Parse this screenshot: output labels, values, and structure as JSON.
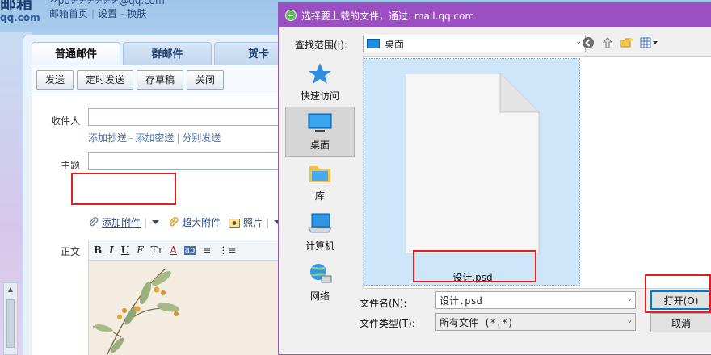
{
  "brand": {
    "logo_main": "邮箱",
    "logo_sub": "qq.com"
  },
  "header": {
    "email": "‹‹pu≠≠≠≠≠≠@qq.com",
    "links": [
      "邮箱首页",
      "设置",
      "换肤"
    ]
  },
  "compose": {
    "tabs": [
      "普通邮件",
      "群邮件",
      "贺卡"
    ],
    "toolbar": [
      "发送",
      "定时发送",
      "存草稿",
      "关闭"
    ],
    "to_label": "收件人",
    "cc_links": [
      "添加抄送",
      "添加密送",
      "分别发送"
    ],
    "subject_label": "主题",
    "attach": {
      "add_attachment": "添加附件",
      "large_attachment": "超大附件",
      "photo": "照片"
    },
    "body_label": "正文",
    "format_buttons": [
      "B",
      "I",
      "U",
      "F",
      "Tᴛ",
      "A",
      "ab",
      "≡",
      "⋮≡"
    ]
  },
  "dialog": {
    "title": "选择要上载的文件，通过: mail.qq.com",
    "lookin_label": "查找范围(I):",
    "lookin_value": "桌面",
    "places": [
      {
        "label": "快速访问",
        "icon": "star-icon"
      },
      {
        "label": "桌面",
        "icon": "desktop-icon"
      },
      {
        "label": "库",
        "icon": "library-icon"
      },
      {
        "label": "计算机",
        "icon": "computer-icon"
      },
      {
        "label": "网络",
        "icon": "network-icon"
      }
    ],
    "file": {
      "name": "设计.psd"
    },
    "filename_label": "文件名(N):",
    "filename_value": "设计.psd",
    "filetype_label": "文件类型(T):",
    "filetype_value": "所有文件 (*.*)",
    "open_button": "打开(O)",
    "cancel_button": "取消"
  },
  "colors": {
    "dialog_titlebar": "#9b4fc2",
    "highlight": "#e02020",
    "selection": "#cde6fa"
  }
}
